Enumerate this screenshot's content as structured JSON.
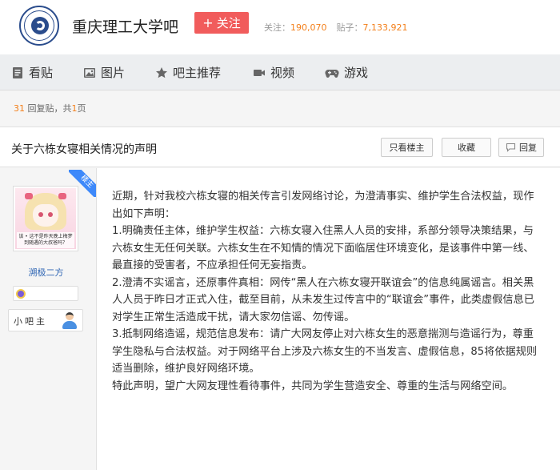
{
  "forum": {
    "name": "重庆理工大学吧",
    "follow_label": "关注",
    "follow_plus": "+",
    "followers_label": "关注：",
    "followers_count": "190,070",
    "posts_label": "贴子：",
    "posts_count": "7,133,921"
  },
  "tabs": [
    {
      "label": "看贴",
      "icon": "document-icon"
    },
    {
      "label": "图片",
      "icon": "image-icon"
    },
    {
      "label": "吧主推荐",
      "icon": "star-icon"
    },
    {
      "label": "视频",
      "icon": "video-icon"
    },
    {
      "label": "游戏",
      "icon": "gamepad-icon"
    }
  ],
  "thread": {
    "reply_count": "31",
    "reply_label": "回复贴，共",
    "page_count": "1",
    "page_suffix": "页",
    "title": "关于六栋女寝相关情况的声明",
    "only_op_label": "只看楼主",
    "favorite_label": "收藏",
    "reply_button_label": "回复"
  },
  "author": {
    "op_ribbon": "楼主",
    "username": "溯极二方",
    "role_label": "小吧主",
    "avatar_caption": "该 • 这不是昨天晚上梅梦到随遇的大叔爸吗？"
  },
  "post": {
    "paragraphs": [
      "近期，针对我校六栋女寝的相关传言引发网络讨论，为澄清事实、维护学生合法权益，现作出如下声明：",
      "1.明确责任主体，维护学生权益：六栋女寝入住黑人人员的安排，系部分领导决策结果，与六栋女生无任何关联。六栋女生在不知情的情况下面临居住环境变化，是该事件中第一线、最直接的受害者，不应承担任何无妄指责。",
      "2.澄清不实谣言，还原事件真相：网传“黑人在六栋女寝开联谊会”的信息纯属谣言。相关黑人人员于昨日才正式入住，截至目前，从未发生过传言中的“联谊会”事件，此类虚假信息已对学生正常生活造成干扰，请大家勿信谣、勿传谣。",
      "3.抵制网络造谣，规范信息发布：请广大网友停止对六栋女生的恶意揣测与造谣行为，尊重学生隐私与合法权益。对于网络平台上涉及六栋女生的不当发言、虚假信息，85将依据规则适当删除，维护良好网络环境。",
      "特此声明，望广大网友理性看待事件，共同为学生营造安全、尊重的生活与网络空间。"
    ]
  },
  "colors": {
    "follow_button": "#f15c5c",
    "accent_orange": "#f37f1a",
    "link_blue": "#2d64b3",
    "op_ribbon": "#3e89fa"
  }
}
